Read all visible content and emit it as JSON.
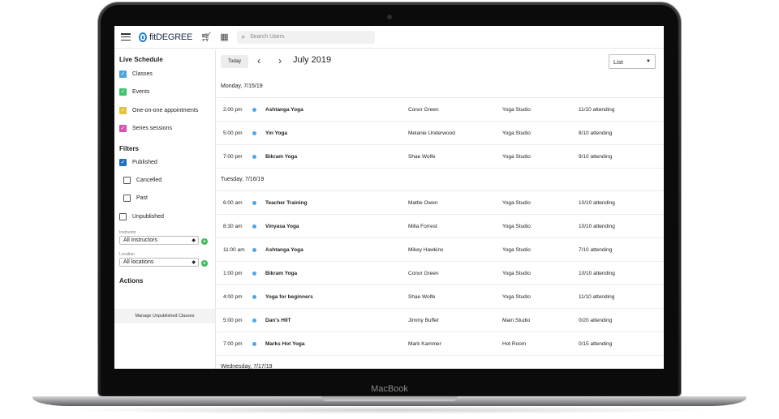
{
  "device": {
    "chin_label": "MacBook"
  },
  "topbar": {
    "logo_text": "fitDEGREE",
    "search_placeholder": "Search Users"
  },
  "sidebar": {
    "live_schedule_heading": "Live Schedule",
    "schedule_filters": [
      {
        "label": "Classes",
        "color": "#4aa3df",
        "checked": true
      },
      {
        "label": "Events",
        "color": "#3cc46a",
        "checked": true
      },
      {
        "label": "One-on-one appointments",
        "color": "#e3c234",
        "checked": true
      },
      {
        "label": "Series sessions",
        "color": "#d94fb8",
        "checked": true
      }
    ],
    "filters_heading": "Filters",
    "status_filters": [
      {
        "label": "Published",
        "checked": true
      },
      {
        "label": "Cancelled",
        "checked": false
      },
      {
        "label": "Past",
        "checked": false
      },
      {
        "label": "Unpublished",
        "checked": false
      }
    ],
    "instructor_label": "Instructor",
    "instructor_value": "All instructors",
    "location_label": "Location",
    "location_value": "All locations",
    "actions_heading": "Actions",
    "manage_button": "Manage Unpublished Classes"
  },
  "toolbar": {
    "today_label": "Today",
    "month_label": "July 2019",
    "view_value": "List"
  },
  "accent": "#4ea6e6",
  "days": [
    {
      "label": "Monday, 7/15/19",
      "events": [
        {
          "time": "2:00 pm",
          "name": "Ashtanga Yoga",
          "instructor": "Conor Green",
          "location": "Yoga Studio",
          "attending": "11/10 attending"
        },
        {
          "time": "5:00 pm",
          "name": "Yin Yoga",
          "instructor": "Melanie Underwood",
          "location": "Yoga Studio",
          "attending": "8/10 attending"
        },
        {
          "time": "7:00 pm",
          "name": "Bikram Yoga",
          "instructor": "Shae Wolfe",
          "location": "Yoga Studio",
          "attending": "9/10 attending"
        }
      ]
    },
    {
      "label": "Tuesday, 7/16/19",
      "events": [
        {
          "time": "6:00 am",
          "name": "Teacher Training",
          "instructor": "Mattie Owen",
          "location": "Yoga Studio",
          "attending": "10/10 attending"
        },
        {
          "time": "8:30 am",
          "name": "Vinyasa Yoga",
          "instructor": "Milla Forrest",
          "location": "Yoga Studio",
          "attending": "10/10 attending"
        },
        {
          "time": "11:00 am",
          "name": "Ashtanga Yoga",
          "instructor": "Mikey Hawkins",
          "location": "Yoga Studio",
          "attending": "7/10 attending"
        },
        {
          "time": "1:00 pm",
          "name": "Bikram Yoga",
          "instructor": "Conor Green",
          "location": "Yoga Studio",
          "attending": "10/10 attending"
        },
        {
          "time": "4:00 pm",
          "name": "Yoga for beginners",
          "instructor": "Shae Wolfe",
          "location": "Yoga Studio",
          "attending": "11/10 attending"
        },
        {
          "time": "5:00 pm",
          "name": "Dan's HIIT",
          "instructor": "Jimmy Buffet",
          "location": "Main Studio",
          "attending": "0/20 attending"
        },
        {
          "time": "7:00 pm",
          "name": "Marks Hot Yoga",
          "instructor": "Mark Kammer",
          "location": "Hot Room",
          "attending": "0/15 attending"
        }
      ]
    },
    {
      "label": "Wednesday, 7/17/19",
      "events": []
    }
  ]
}
